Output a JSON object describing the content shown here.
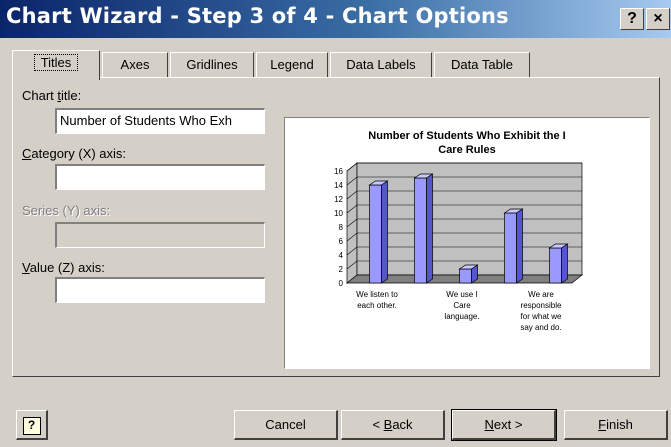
{
  "window": {
    "title": "Chart Wizard - Step 3 of 4 - Chart Options",
    "help_button": "?",
    "close_button": "×"
  },
  "tabs": [
    {
      "label": "Titles",
      "active": true
    },
    {
      "label": "Axes"
    },
    {
      "label": "Gridlines"
    },
    {
      "label": "Legend"
    },
    {
      "label": "Data Labels"
    },
    {
      "label": "Data Table"
    }
  ],
  "fields": {
    "chart_title": {
      "pre": "Chart ",
      "mnemonic": "t",
      "post": "itle:",
      "value": "Number of Students Who Exh"
    },
    "category_axis": {
      "pre": "",
      "mnemonic": "C",
      "post": "ategory (X) axis:",
      "value": ""
    },
    "series_axis": {
      "label": "Series (Y) axis:",
      "value": "",
      "enabled": false
    },
    "value_axis": {
      "pre": "",
      "mnemonic": "V",
      "post": "alue (Z) axis:",
      "value": ""
    }
  },
  "chart_data": {
    "type": "bar",
    "title": "Number of Students Who Exhibit the I Care Rules",
    "title_lines": [
      "Number of Students Who Exhibit the I",
      "Care Rules"
    ],
    "categories": [
      [
        "We listen to",
        "each other."
      ],
      [
        "We use I",
        "Care",
        "language."
      ],
      [
        "We are",
        "responsible",
        "for what we",
        "say and do."
      ]
    ],
    "series": [
      {
        "values": [
          14,
          15,
          2,
          10,
          5
        ],
        "color": "#9999ff"
      }
    ],
    "ylim": [
      0,
      16
    ],
    "yticks": [
      0,
      2,
      4,
      6,
      8,
      10,
      12,
      14,
      16
    ],
    "grid": true,
    "style": "3d-column",
    "wall_color": "#c0c0c0",
    "floor_color": "#808080"
  },
  "buttons": {
    "help_icon": "?",
    "cancel": "Cancel",
    "back": {
      "pre": "< ",
      "mnemonic": "B",
      "post": "ack"
    },
    "next": {
      "pre": "",
      "mnemonic": "N",
      "post": "ext >"
    },
    "finish": {
      "pre": "",
      "mnemonic": "F",
      "post": "inish"
    }
  }
}
